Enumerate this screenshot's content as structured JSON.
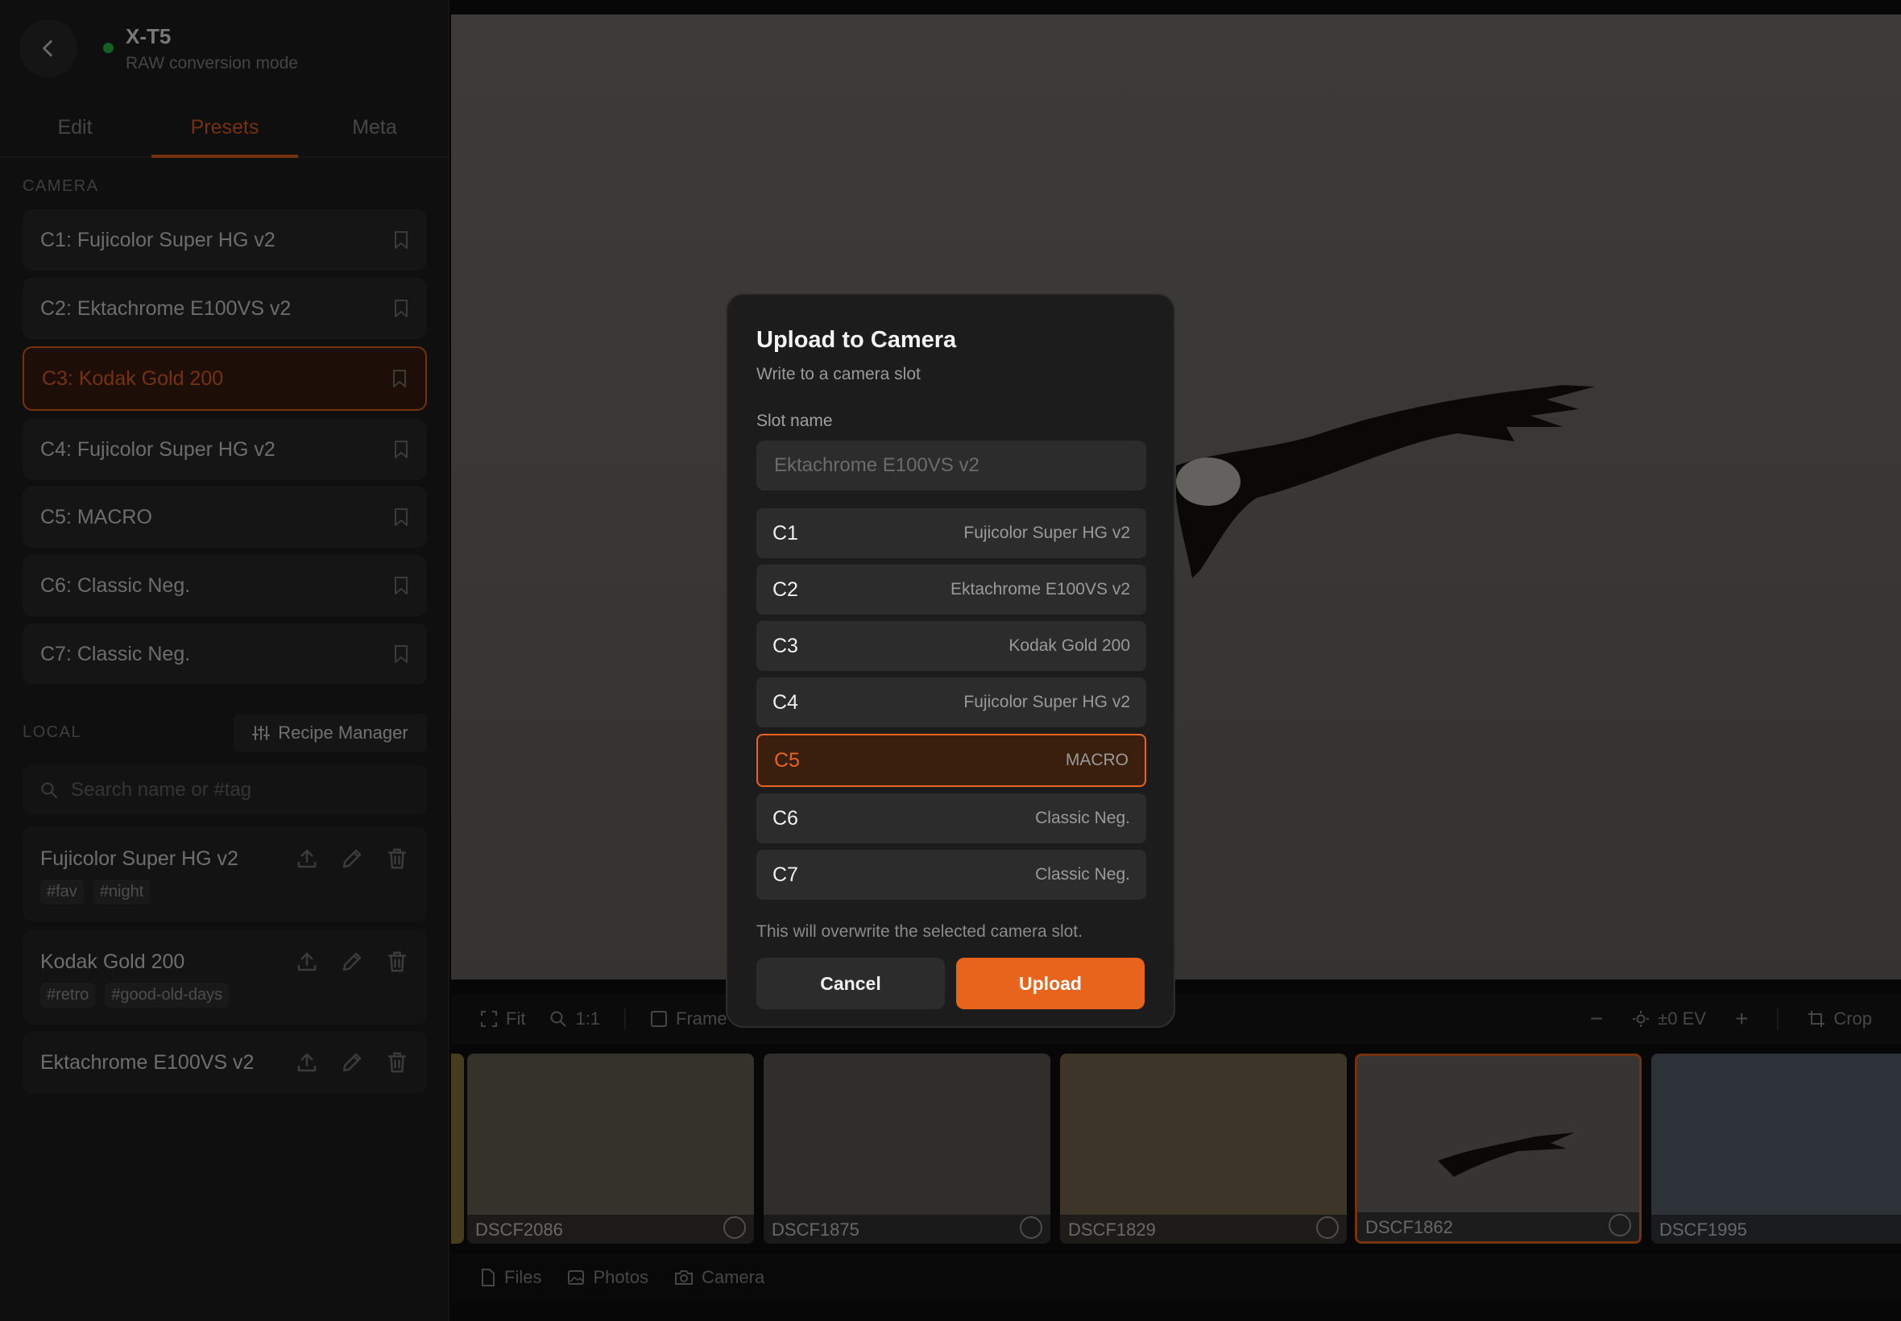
{
  "device": {
    "name": "X-T5",
    "mode": "RAW conversion mode"
  },
  "tabs": [
    "Edit",
    "Presets",
    "Meta"
  ],
  "sections": {
    "camera": "CAMERA",
    "local": "LOCAL"
  },
  "camera_slots": [
    "C1: Fujicolor Super HG v2",
    "C2: Ektachrome E100VS v2",
    "C3: Kodak Gold 200",
    "C4: Fujicolor Super HG v2",
    "C5: MACRO",
    "C6: Classic Neg.",
    "C7: Classic Neg."
  ],
  "recipe_manager": "Recipe Manager",
  "search": {
    "placeholder": "Search name or #tag"
  },
  "local_recipes": [
    {
      "name": "Fujicolor Super HG v2",
      "tags": [
        "#fav",
        "#night"
      ]
    },
    {
      "name": "Kodak Gold 200",
      "tags": [
        "#retro",
        "#good-old-days"
      ]
    },
    {
      "name": "Ektachrome E100VS v2",
      "tags": []
    }
  ],
  "toolbar": {
    "fit": "Fit",
    "zoom": "1:1",
    "frame": "Frame",
    "ev": "±0 EV",
    "crop": "Crop"
  },
  "filmstrip": [
    "DSCF2086",
    "DSCF1875",
    "DSCF1829",
    "DSCF1862",
    "DSCF1995"
  ],
  "bottom_nav": {
    "files": "Files",
    "photos": "Photos",
    "camera": "Camera"
  },
  "modal": {
    "title": "Upload to Camera",
    "subtitle": "Write to a camera slot",
    "field_label": "Slot name",
    "placeholder": "Ektachrome E100VS v2",
    "options": [
      {
        "code": "C1",
        "value": "Fujicolor Super HG v2"
      },
      {
        "code": "C2",
        "value": "Ektachrome E100VS v2"
      },
      {
        "code": "C3",
        "value": "Kodak Gold 200"
      },
      {
        "code": "C4",
        "value": "Fujicolor Super HG v2"
      },
      {
        "code": "C5",
        "value": "MACRO"
      },
      {
        "code": "C6",
        "value": "Classic Neg."
      },
      {
        "code": "C7",
        "value": "Classic Neg."
      }
    ],
    "warning": "This will overwrite the selected camera slot.",
    "cancel": "Cancel",
    "upload": "Upload"
  },
  "colors": {
    "accent": "#e8641c",
    "status_online": "#27c24c"
  }
}
